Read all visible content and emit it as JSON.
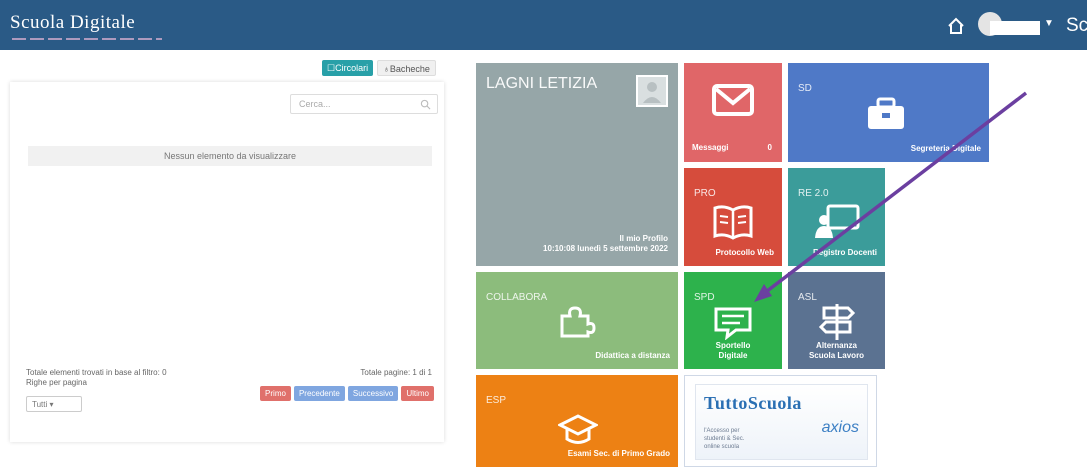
{
  "header": {
    "logo": "Scuola Digitale",
    "user_text": "Sc",
    "colors": {
      "bar": "#2a5a86"
    }
  },
  "toggles": {
    "active_label": "Circolari",
    "inactive_label": "Bacheche"
  },
  "list": {
    "search_placeholder": "Cerca...",
    "empty_message": "Nessun elemento da visualizzare",
    "total_filtered": "Totale elementi trovati in base al filtro: 0",
    "rows_per_page_label": "Righe per pagina",
    "total_pages": "Totale pagine: 1 di 1",
    "rows_select_value": "Tutti",
    "pager": {
      "first": "Primo",
      "prev": "Precedente",
      "next": "Successivo",
      "last": "Ultimo"
    }
  },
  "tiles": {
    "profile": {
      "name": "LAGNI LETIZIA",
      "label": "Il mio Profilo",
      "datetime": "10:10:08 lunedì 5 settembre 2022"
    },
    "messages": {
      "label": "Messaggi",
      "count": "0"
    },
    "sd": {
      "code": "SD",
      "label": "Segreteria Digitale"
    },
    "pro": {
      "code": "PRO",
      "label": "Protocollo Web"
    },
    "re": {
      "code": "RE 2.0",
      "label": "Registro Docenti"
    },
    "collabora": {
      "code": "COLLABORA",
      "label": "Didattica a distanza"
    },
    "spd": {
      "code": "SPD",
      "label_line1": "Sportello",
      "label_line2": "Digitale"
    },
    "asl": {
      "code": "ASL",
      "label_line1": "Alternanza",
      "label_line2": "Scuola Lavoro"
    },
    "esp": {
      "code": "ESP",
      "label": "Esami Sec. di Primo Grado"
    },
    "tuttoscuola": {
      "title": "TuttoScuola",
      "brand": "axios",
      "line1": "l'Accesso per",
      "line2": "studenti & Sec.",
      "line3": "online scuola"
    }
  }
}
